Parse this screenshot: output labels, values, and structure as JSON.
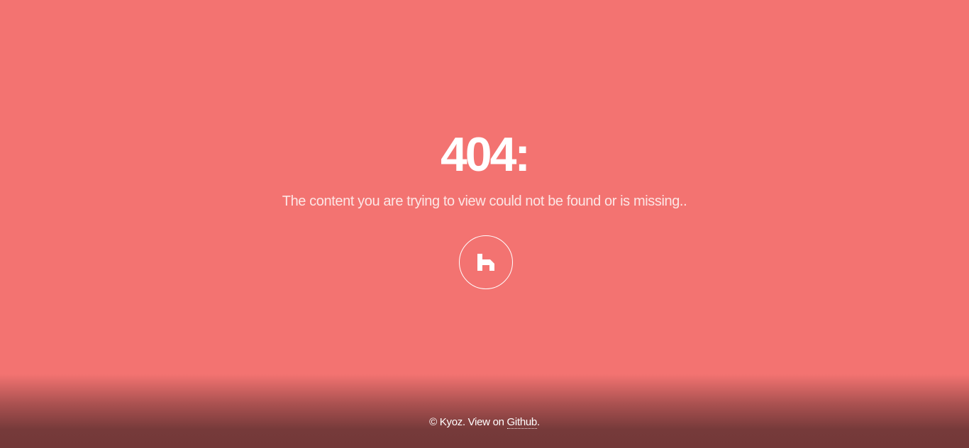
{
  "error": {
    "title": "404:",
    "message": "The content you are trying to view could not be found or is missing.."
  },
  "home_button": {
    "icon": "home-icon"
  },
  "footer": {
    "copyright": "© Kyoz. View on ",
    "link_label": "Github",
    "suffix": "."
  },
  "colors": {
    "background": "#f37371",
    "footer_dark": "#763a3a",
    "text": "#ffffff"
  }
}
